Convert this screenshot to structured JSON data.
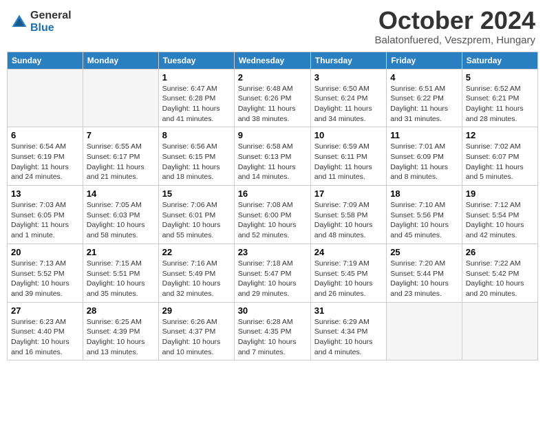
{
  "logo": {
    "general": "General",
    "blue": "Blue"
  },
  "title": "October 2024",
  "subtitle": "Balatonfuered, Veszprem, Hungary",
  "headers": [
    "Sunday",
    "Monday",
    "Tuesday",
    "Wednesday",
    "Thursday",
    "Friday",
    "Saturday"
  ],
  "weeks": [
    [
      {
        "num": "",
        "info": ""
      },
      {
        "num": "",
        "info": ""
      },
      {
        "num": "1",
        "info": "Sunrise: 6:47 AM\nSunset: 6:28 PM\nDaylight: 11 hours and 41 minutes."
      },
      {
        "num": "2",
        "info": "Sunrise: 6:48 AM\nSunset: 6:26 PM\nDaylight: 11 hours and 38 minutes."
      },
      {
        "num": "3",
        "info": "Sunrise: 6:50 AM\nSunset: 6:24 PM\nDaylight: 11 hours and 34 minutes."
      },
      {
        "num": "4",
        "info": "Sunrise: 6:51 AM\nSunset: 6:22 PM\nDaylight: 11 hours and 31 minutes."
      },
      {
        "num": "5",
        "info": "Sunrise: 6:52 AM\nSunset: 6:21 PM\nDaylight: 11 hours and 28 minutes."
      }
    ],
    [
      {
        "num": "6",
        "info": "Sunrise: 6:54 AM\nSunset: 6:19 PM\nDaylight: 11 hours and 24 minutes."
      },
      {
        "num": "7",
        "info": "Sunrise: 6:55 AM\nSunset: 6:17 PM\nDaylight: 11 hours and 21 minutes."
      },
      {
        "num": "8",
        "info": "Sunrise: 6:56 AM\nSunset: 6:15 PM\nDaylight: 11 hours and 18 minutes."
      },
      {
        "num": "9",
        "info": "Sunrise: 6:58 AM\nSunset: 6:13 PM\nDaylight: 11 hours and 14 minutes."
      },
      {
        "num": "10",
        "info": "Sunrise: 6:59 AM\nSunset: 6:11 PM\nDaylight: 11 hours and 11 minutes."
      },
      {
        "num": "11",
        "info": "Sunrise: 7:01 AM\nSunset: 6:09 PM\nDaylight: 11 hours and 8 minutes."
      },
      {
        "num": "12",
        "info": "Sunrise: 7:02 AM\nSunset: 6:07 PM\nDaylight: 11 hours and 5 minutes."
      }
    ],
    [
      {
        "num": "13",
        "info": "Sunrise: 7:03 AM\nSunset: 6:05 PM\nDaylight: 11 hours and 1 minute."
      },
      {
        "num": "14",
        "info": "Sunrise: 7:05 AM\nSunset: 6:03 PM\nDaylight: 10 hours and 58 minutes."
      },
      {
        "num": "15",
        "info": "Sunrise: 7:06 AM\nSunset: 6:01 PM\nDaylight: 10 hours and 55 minutes."
      },
      {
        "num": "16",
        "info": "Sunrise: 7:08 AM\nSunset: 6:00 PM\nDaylight: 10 hours and 52 minutes."
      },
      {
        "num": "17",
        "info": "Sunrise: 7:09 AM\nSunset: 5:58 PM\nDaylight: 10 hours and 48 minutes."
      },
      {
        "num": "18",
        "info": "Sunrise: 7:10 AM\nSunset: 5:56 PM\nDaylight: 10 hours and 45 minutes."
      },
      {
        "num": "19",
        "info": "Sunrise: 7:12 AM\nSunset: 5:54 PM\nDaylight: 10 hours and 42 minutes."
      }
    ],
    [
      {
        "num": "20",
        "info": "Sunrise: 7:13 AM\nSunset: 5:52 PM\nDaylight: 10 hours and 39 minutes."
      },
      {
        "num": "21",
        "info": "Sunrise: 7:15 AM\nSunset: 5:51 PM\nDaylight: 10 hours and 35 minutes."
      },
      {
        "num": "22",
        "info": "Sunrise: 7:16 AM\nSunset: 5:49 PM\nDaylight: 10 hours and 32 minutes."
      },
      {
        "num": "23",
        "info": "Sunrise: 7:18 AM\nSunset: 5:47 PM\nDaylight: 10 hours and 29 minutes."
      },
      {
        "num": "24",
        "info": "Sunrise: 7:19 AM\nSunset: 5:45 PM\nDaylight: 10 hours and 26 minutes."
      },
      {
        "num": "25",
        "info": "Sunrise: 7:20 AM\nSunset: 5:44 PM\nDaylight: 10 hours and 23 minutes."
      },
      {
        "num": "26",
        "info": "Sunrise: 7:22 AM\nSunset: 5:42 PM\nDaylight: 10 hours and 20 minutes."
      }
    ],
    [
      {
        "num": "27",
        "info": "Sunrise: 6:23 AM\nSunset: 4:40 PM\nDaylight: 10 hours and 16 minutes."
      },
      {
        "num": "28",
        "info": "Sunrise: 6:25 AM\nSunset: 4:39 PM\nDaylight: 10 hours and 13 minutes."
      },
      {
        "num": "29",
        "info": "Sunrise: 6:26 AM\nSunset: 4:37 PM\nDaylight: 10 hours and 10 minutes."
      },
      {
        "num": "30",
        "info": "Sunrise: 6:28 AM\nSunset: 4:35 PM\nDaylight: 10 hours and 7 minutes."
      },
      {
        "num": "31",
        "info": "Sunrise: 6:29 AM\nSunset: 4:34 PM\nDaylight: 10 hours and 4 minutes."
      },
      {
        "num": "",
        "info": ""
      },
      {
        "num": "",
        "info": ""
      }
    ]
  ]
}
